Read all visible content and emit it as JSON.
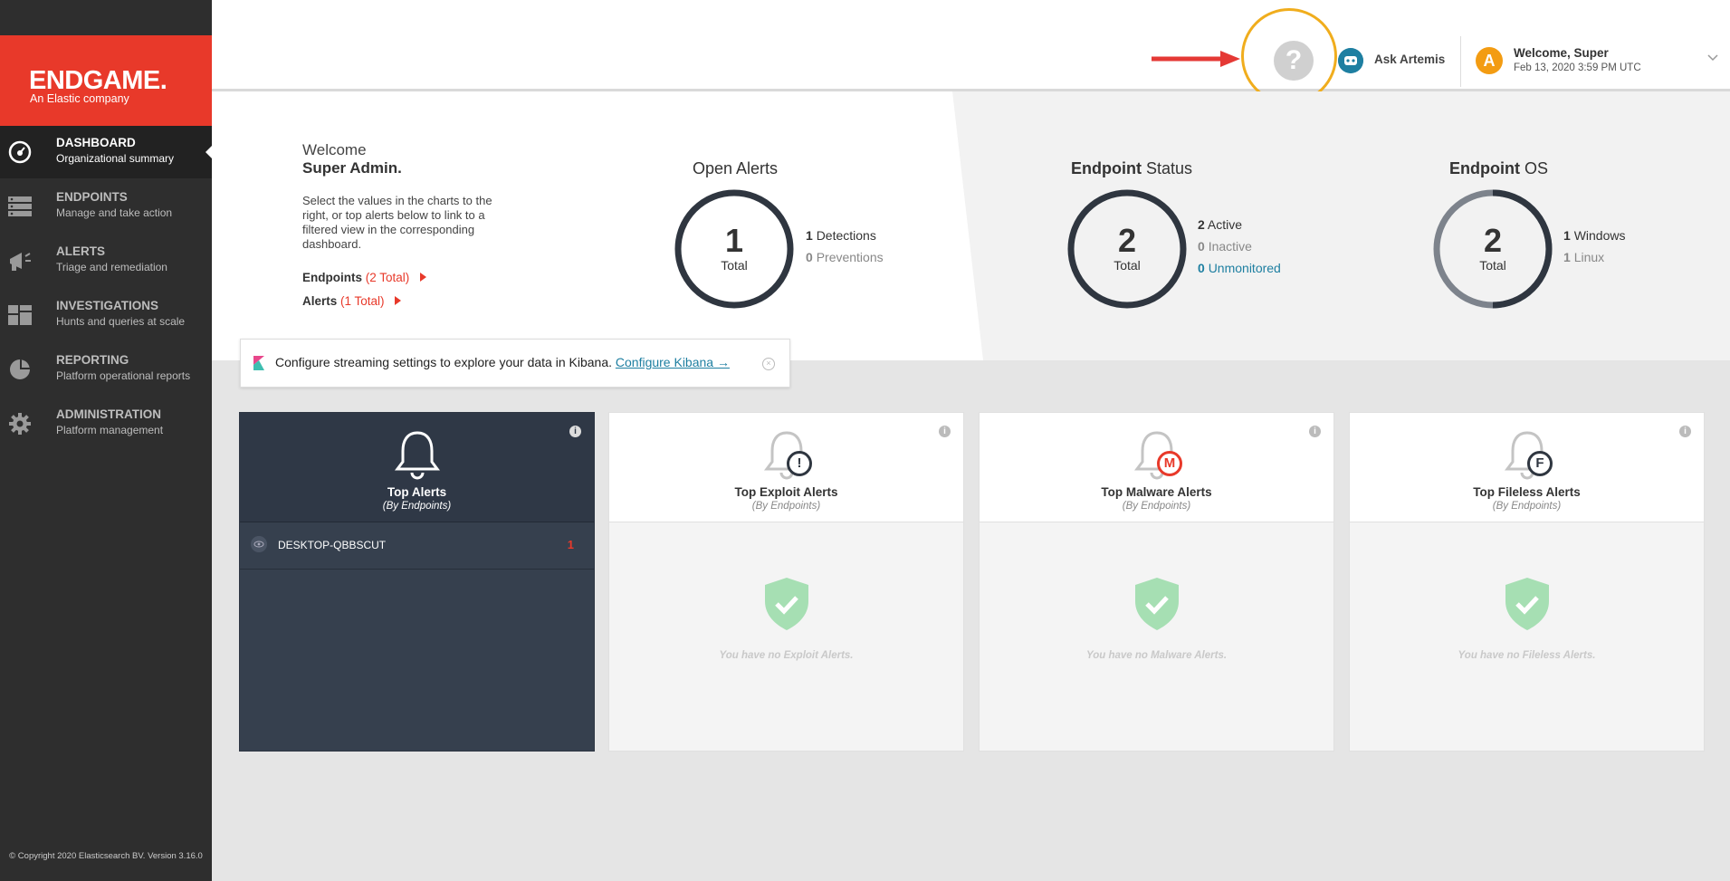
{
  "brand": {
    "name": "ENDGAME.",
    "tagline": "An Elastic company"
  },
  "sidebar": {
    "items": [
      {
        "title": "DASHBOARD",
        "subtitle": "Organizational summary",
        "icon": "dashboard-gauge-icon"
      },
      {
        "title": "ENDPOINTS",
        "subtitle": "Manage and take action",
        "icon": "server-stack-icon"
      },
      {
        "title": "ALERTS",
        "subtitle": "Triage and remediation",
        "icon": "megaphone-icon"
      },
      {
        "title": "INVESTIGATIONS",
        "subtitle": "Hunts and queries at scale",
        "icon": "blocks-icon"
      },
      {
        "title": "REPORTING",
        "subtitle": "Platform operational reports",
        "icon": "pie-chart-icon"
      },
      {
        "title": "ADMINISTRATION",
        "subtitle": "Platform management",
        "icon": "gear-icon"
      }
    ],
    "copyright": "© Copyright 2020 Elasticsearch BV. Version 3.16.0"
  },
  "header": {
    "help_icon": "?",
    "ask_label": "Ask Artemis",
    "avatar_letter": "A",
    "welcome_name": "Welcome, Super",
    "welcome_date": "Feb 13, 2020 3:59 PM UTC"
  },
  "welcome": {
    "greeting": "Welcome",
    "name": "Super Admin.",
    "description": "Select the values in the charts to the right, or top alerts below to link to a filtered view in the corresponding dashboard.",
    "endpoints_label": "Endpoints",
    "endpoints_count": "(2 Total)",
    "alerts_label": "Alerts",
    "alerts_count": "(1 Total)"
  },
  "open_alerts": {
    "title": "Open Alerts",
    "total": "1",
    "total_label": "Total",
    "detections_count": "1",
    "detections_label": "Detections",
    "preventions_count": "0",
    "preventions_label": "Preventions"
  },
  "endpoint_status": {
    "title_bold": "Endpoint",
    "title_rest": "Status",
    "total": "2",
    "total_label": "Total",
    "active_count": "2",
    "active_label": "Active",
    "inactive_count": "0",
    "inactive_label": "Inactive",
    "unmonitored_count": "0",
    "unmonitored_label": "Unmonitored"
  },
  "endpoint_os": {
    "title_bold": "Endpoint",
    "title_rest": "OS",
    "total": "2",
    "total_label": "Total",
    "windows_count": "1",
    "windows_label": "Windows",
    "linux_count": "1",
    "linux_label": "Linux",
    "windows_share": 0.5
  },
  "kibana_banner": {
    "text": "Configure streaming settings to explore your data in Kibana.",
    "link": "Configure Kibana →",
    "close_icon": "×"
  },
  "cards": [
    {
      "title": "Top Alerts",
      "subtitle": "(By Endpoints)",
      "rows": [
        {
          "host": "DESKTOP-QBBSCUT",
          "count": "1"
        }
      ]
    },
    {
      "title": "Top Exploit Alerts",
      "subtitle": "(By Endpoints)",
      "badge": "!",
      "empty": "You have no Exploit Alerts."
    },
    {
      "title": "Top Malware Alerts",
      "subtitle": "(By Endpoints)",
      "badge": "M",
      "empty": "You have no Malware Alerts."
    },
    {
      "title": "Top Fileless Alerts",
      "subtitle": "(By Endpoints)",
      "badge": "F",
      "empty": "You have no Fileless Alerts."
    }
  ],
  "colors": {
    "brand_red": "#e8392a",
    "sidebar": "#2e2e2e",
    "accent_blue": "#1e7fa1",
    "highlight_ring": "#f0ad1d",
    "card_dark": "#36404e"
  }
}
